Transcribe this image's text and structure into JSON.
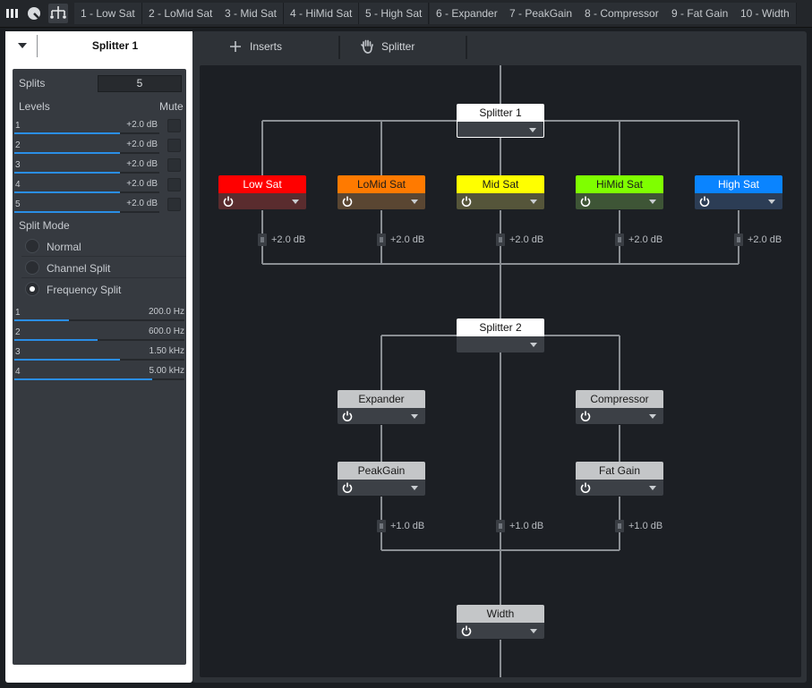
{
  "tabs": [
    {
      "label": "1 - Low Sat"
    },
    {
      "label": "2 - LoMid Sat"
    },
    {
      "label": "3 - Mid Sat"
    },
    {
      "label": "4 - HiMid Sat"
    },
    {
      "label": "5 - High Sat"
    },
    {
      "label": "6 - Expander"
    },
    {
      "label": "7 - PeakGain"
    },
    {
      "label": "8 - Compressor"
    },
    {
      "label": "9 - Fat Gain"
    },
    {
      "label": "10 - Width"
    }
  ],
  "left": {
    "title": "Splitter 1",
    "splits_label": "Splits",
    "splits_value": "5",
    "levels_label": "Levels",
    "mute_label": "Mute",
    "levels": [
      {
        "num": "1",
        "value": "+2.0 dB",
        "fill": 0.73
      },
      {
        "num": "2",
        "value": "+2.0 dB",
        "fill": 0.73
      },
      {
        "num": "3",
        "value": "+2.0 dB",
        "fill": 0.73
      },
      {
        "num": "4",
        "value": "+2.0 dB",
        "fill": 0.73
      },
      {
        "num": "5",
        "value": "+2.0 dB",
        "fill": 0.73
      }
    ],
    "split_mode_label": "Split Mode",
    "modes": [
      {
        "label": "Normal",
        "selected": false
      },
      {
        "label": "Channel Split",
        "selected": false
      },
      {
        "label": "Frequency Split",
        "selected": true
      }
    ],
    "freqs": [
      {
        "num": "1",
        "value": "200.0 Hz",
        "fill": 0.32
      },
      {
        "num": "2",
        "value": "600.0 Hz",
        "fill": 0.49
      },
      {
        "num": "3",
        "value": "1.50 kHz",
        "fill": 0.62
      },
      {
        "num": "4",
        "value": "5.00 kHz",
        "fill": 0.81
      }
    ]
  },
  "toolbar": {
    "inserts_label": "Inserts",
    "splitter_label": "Splitter"
  },
  "routing": {
    "splitter1": {
      "label": "Splitter 1"
    },
    "bands": [
      {
        "label": "Low Sat",
        "color": "#ff0000",
        "text_color": "#ffffff",
        "foot": "#5a2c2e"
      },
      {
        "label": "LoMid Sat",
        "color": "#ff7a00",
        "text_color": "#1a1a1a",
        "foot": "#5a4632"
      },
      {
        "label": "Mid Sat",
        "color": "#ffff00",
        "text_color": "#1a1a1a",
        "foot": "#55553a"
      },
      {
        "label": "HiMid Sat",
        "color": "#7fff00",
        "text_color": "#1a1a1a",
        "foot": "#3e5536"
      },
      {
        "label": "High Sat",
        "color": "#0a84ff",
        "text_color": "#ffffff",
        "foot": "#2c3d55"
      }
    ],
    "band_gains": [
      "+2.0 dB",
      "+2.0 dB",
      "+2.0 dB",
      "+2.0 dB",
      "+2.0 dB"
    ],
    "splitter2": {
      "label": "Splitter 2"
    },
    "expander": {
      "label": "Expander"
    },
    "compressor": {
      "label": "Compressor"
    },
    "peakgain": {
      "label": "PeakGain"
    },
    "fatgain": {
      "label": "Fat Gain"
    },
    "lower_gains": [
      "+1.0 dB",
      "+1.0 dB",
      "+1.0 dB"
    ],
    "width": {
      "label": "Width"
    }
  }
}
